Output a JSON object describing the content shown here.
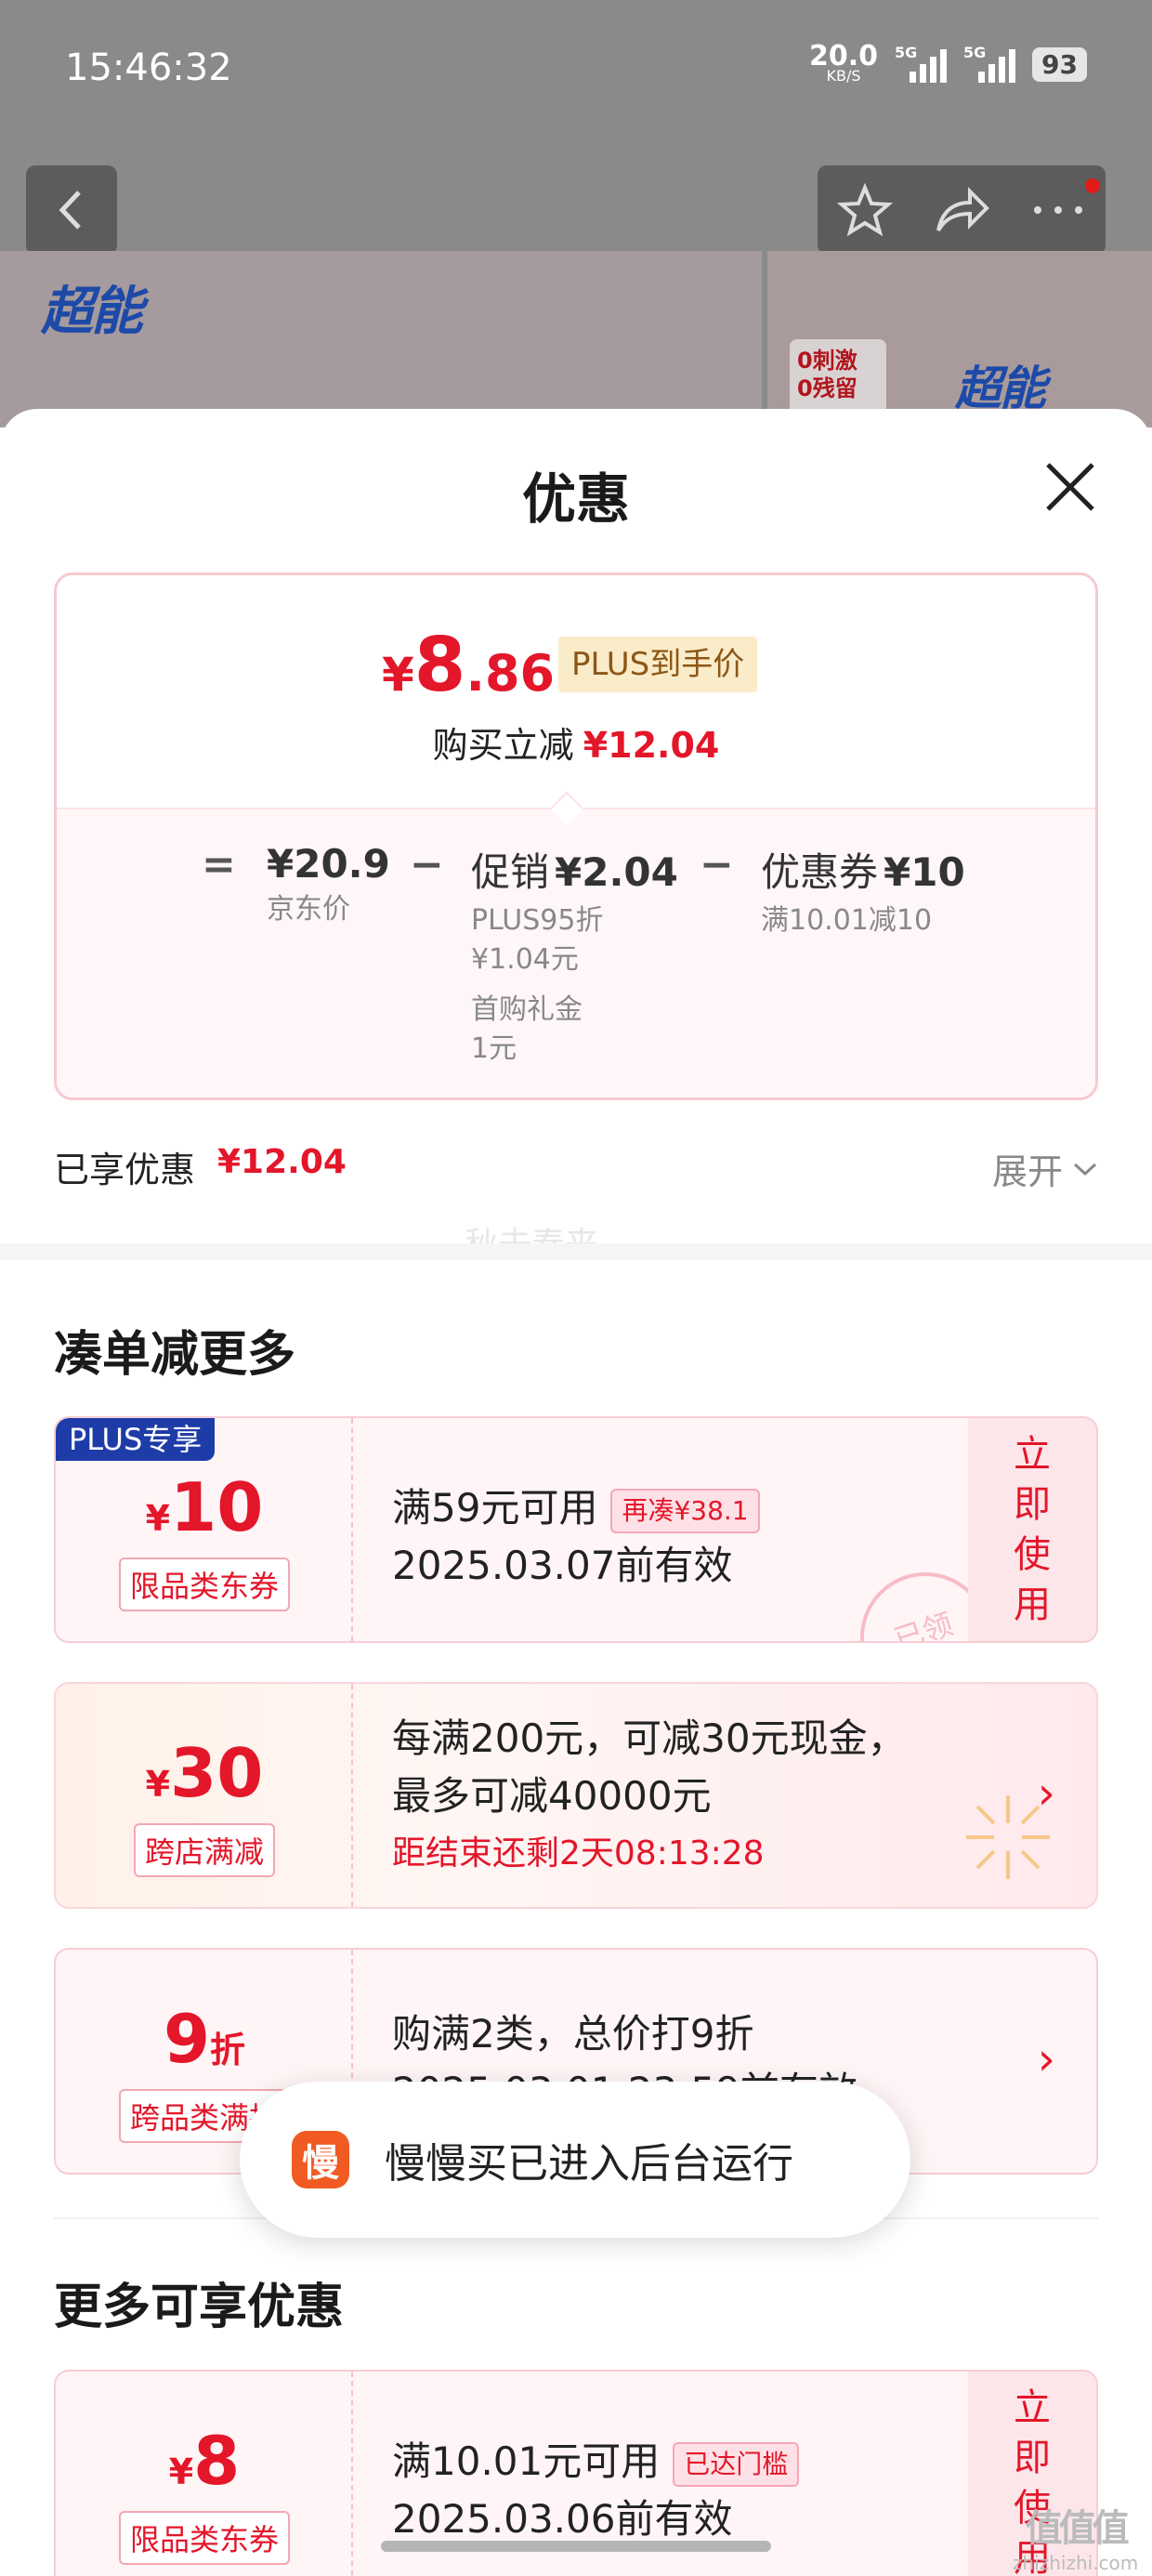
{
  "status_bar": {
    "time": "15:46:32",
    "net_speed": "20.0",
    "net_unit": "KB/S",
    "sim1": "5G",
    "sim2": "5G",
    "battery": "93"
  },
  "product": {
    "brand_left": "超能",
    "brand_right": "超能",
    "tag_line1": "0刺激",
    "tag_line2": "0残留"
  },
  "sheet": {
    "title": "优惠",
    "summary": {
      "price_symbol": "¥",
      "price_int": "8",
      "price_dec": ".86",
      "plus_badge": "PLUS到手价",
      "reduce_label": "购买立减",
      "reduce_amount": "¥12.04",
      "equals": "=",
      "minus": "−",
      "jd_price": "¥20.9",
      "jd_label": "京东价",
      "promo_label": "促销",
      "promo_amount": "¥2.04",
      "promo_detail1_a": "PLUS95折",
      "promo_detail1_b": "¥1.04元",
      "promo_detail2_a": "首购礼金",
      "promo_detail2_b": "1元",
      "coupon_label": "优惠券",
      "coupon_amount": "¥10",
      "coupon_detail": "满10.01减10"
    },
    "enjoyed_label": "已享优惠",
    "enjoyed_amount": "¥12.04",
    "expand_label": "展开",
    "watermark": "秋去春来",
    "section1_title": "凑单减更多",
    "section2_title": "更多可享优惠",
    "coupons": [
      {
        "plus_tag": "PLUS专享",
        "symbol": "¥",
        "amount": "10",
        "tag": "限品类东券",
        "line1": "满59元可用",
        "hint": "再凑¥38.1",
        "line2": "2025.03.07前有效",
        "cta": "立即使用",
        "stamp": "已领"
      },
      {
        "symbol": "¥",
        "amount": "30",
        "tag": "跨店满减",
        "line1": "每满200元，可减30元现金，",
        "line2": "最多可减40000元",
        "line3": "距结束还剩2天08:13:28"
      },
      {
        "amount": "9",
        "unit": "折",
        "tag": "跨品类满折",
        "line1": "购满2类，总价打9折",
        "line2": "2025.03.01 23:59前有效"
      },
      {
        "symbol": "¥",
        "amount": "8",
        "tag": "限品类东券",
        "line1": "满10.01元可用",
        "hint": "已达门槛",
        "line2": "2025.03.06前有效",
        "cta": "立即使用"
      }
    ],
    "toast": {
      "icon_char": "慢",
      "text": "慢慢买已进入后台运行"
    }
  },
  "footer": {
    "site_logo": "值值值",
    "site_url": "zhizhizhi.com"
  },
  "colors": {
    "accent_red": "#e4162a",
    "plus_blue": "#1e3ca8",
    "plus_gold_bg": "#fbecc9"
  }
}
